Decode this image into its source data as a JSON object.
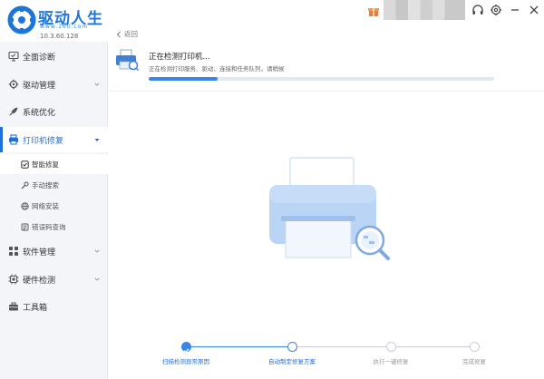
{
  "app": {
    "name": "驱动人生",
    "url": "www.160.com",
    "version": "10.3.60.128"
  },
  "colors": {
    "accent": "#1f6fd8",
    "progress": "#3a86e8",
    "sidebar_bg": "#f3f5f9",
    "step_done": "#3a86e8",
    "step_pending": "#c9ced6"
  },
  "titlebar_icons": [
    "gift-icon",
    "headset-icon",
    "settings-icon",
    "minimize-icon",
    "close-icon"
  ],
  "sidebar": {
    "items": [
      {
        "label": "全面诊断",
        "icon": "monitor-check-icon"
      },
      {
        "label": "驱动管理",
        "icon": "gear-icon",
        "expandable": true
      },
      {
        "label": "系统优化",
        "icon": "rocket-icon"
      },
      {
        "label": "打印机修复",
        "icon": "printer-icon",
        "expandable": true,
        "active": true
      },
      {
        "label": "软件管理",
        "icon": "apps-icon",
        "expandable": true
      },
      {
        "label": "硬件检测",
        "icon": "chip-icon",
        "expandable": true
      },
      {
        "label": "工具箱",
        "icon": "toolbox-icon"
      }
    ],
    "sub_items": [
      {
        "label": "智能修复",
        "icon": "smart-repair-icon",
        "active": true
      },
      {
        "label": "手动搜索",
        "icon": "wrench-icon"
      },
      {
        "label": "网络安装",
        "icon": "globe-icon"
      },
      {
        "label": "错误码查询",
        "icon": "error-code-icon"
      }
    ]
  },
  "main": {
    "back_label": "返回",
    "status_title": "正在检测打印机...",
    "status_desc": "正在检测打印服务、驱动、连接和任务队列，请稍候",
    "progress": 0.2
  },
  "steps": [
    {
      "label": "扫描检测异常原因",
      "state": "done"
    },
    {
      "label": "自动制定修复方案",
      "state": "current"
    },
    {
      "label": "执行一键修复",
      "state": "pending"
    },
    {
      "label": "完成修复",
      "state": "pending"
    }
  ]
}
